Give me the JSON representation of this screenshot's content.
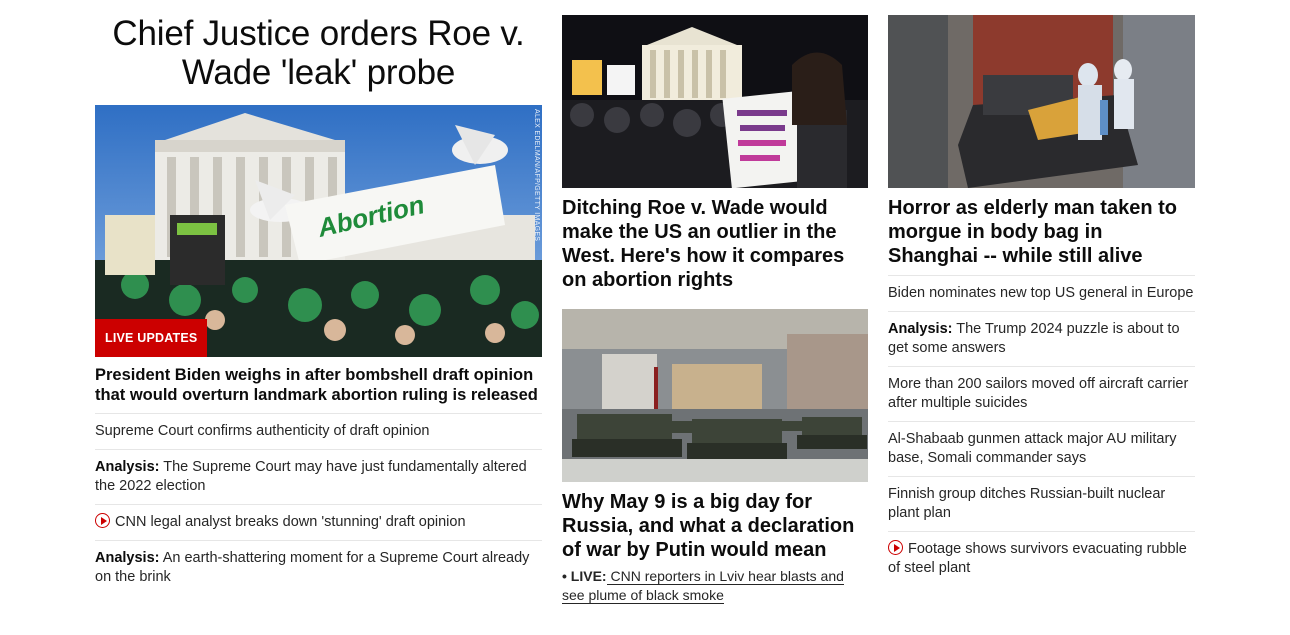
{
  "lead": {
    "title": "Chief Justice orders Roe v. Wade 'leak' probe",
    "badge": "LIVE UPDATES",
    "photo_credit": "ALEX EDELMAN/AFP/GETTY IMAGES",
    "banner_text": "Abortion",
    "headline": "President Biden weighs in after bombshell draft opinion that would overturn landmark abortion ruling is released",
    "items": [
      {
        "prefix": "",
        "text": "Supreme Court confirms authenticity of draft opinion",
        "video": false
      },
      {
        "prefix": "Analysis:",
        "text": " The Supreme Court may have just fundamentally altered the 2022 election",
        "video": false
      },
      {
        "prefix": "",
        "text": "CNN legal analyst breaks down 'stunning' draft opinion",
        "video": true
      },
      {
        "prefix": "Analysis:",
        "text": " An earth-shattering moment for a Supreme Court already on the brink",
        "video": false
      }
    ]
  },
  "middle": {
    "card1": {
      "headline": "Ditching Roe v. Wade would make the US an outlier in the West. Here's how it compares on abortion rights"
    },
    "card2": {
      "headline": "Why May 9 is a big day for Russia, and what a declaration of war by Putin would mean",
      "live_prefix": "• LIVE:",
      "live_text": " CNN reporters in Lviv hear blasts and see plume of black smoke"
    }
  },
  "right": {
    "headline": "Horror as elderly man taken to morgue in body bag in Shanghai -- while still alive",
    "items": [
      {
        "prefix": "",
        "text": "Biden nominates new top US general in Europe",
        "video": false
      },
      {
        "prefix": "Analysis:",
        "text": " The Trump 2024 puzzle is about to get some answers",
        "video": false
      },
      {
        "prefix": "",
        "text": "More than 200 sailors moved off aircraft carrier after multiple suicides",
        "video": false
      },
      {
        "prefix": "",
        "text": "Al-Shabaab gunmen attack major AU military base, Somali commander says",
        "video": false
      },
      {
        "prefix": "",
        "text": "Finnish group ditches Russian-built nuclear plant plan",
        "video": false
      },
      {
        "prefix": "",
        "text": "Footage shows survivors evacuating rubble of steel plant",
        "video": true
      }
    ]
  },
  "colors": {
    "accent_red": "#cc0000",
    "divider": "#e6e6e6",
    "text": "#0c0c0c"
  }
}
